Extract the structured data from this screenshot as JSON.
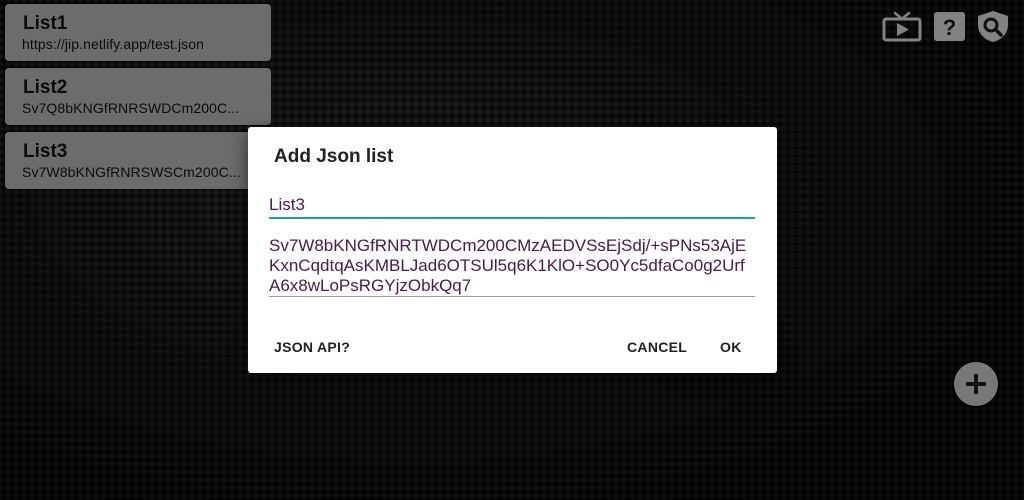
{
  "lists": [
    {
      "title": "List1",
      "subtitle": "https://jip.netlify.app/test.json"
    },
    {
      "title": "List2",
      "subtitle": "Sv7Q8bKNGfRNRSWDCm200C..."
    },
    {
      "title": "List3",
      "subtitle": "Sv7W8bKNGfRNRSWSCm200C..."
    }
  ],
  "toolbar": {
    "icons": [
      "tv-play-icon",
      "help-icon",
      "shield-search-icon"
    ]
  },
  "fab": {
    "icon": "plus-icon"
  },
  "dialog": {
    "title": "Add Json list",
    "name_value": "List3",
    "json_value": "Sv7W8bKNGfRNRTWDCm200CMzAEDVSsEjSdj/+sPNs53AjEKxnCqdtqAsKMBLJad6OTSUl5q6K1KlO+SO0Yc5dfaCo0g2UrfA6x8wLoPsRGYjzObkQq7",
    "buttons": {
      "api": "JSON API?",
      "cancel": "CANCEL",
      "ok": "OK"
    }
  },
  "colors": {
    "accent": "#2a9d8f",
    "item_bg": "#a6a6a6"
  }
}
